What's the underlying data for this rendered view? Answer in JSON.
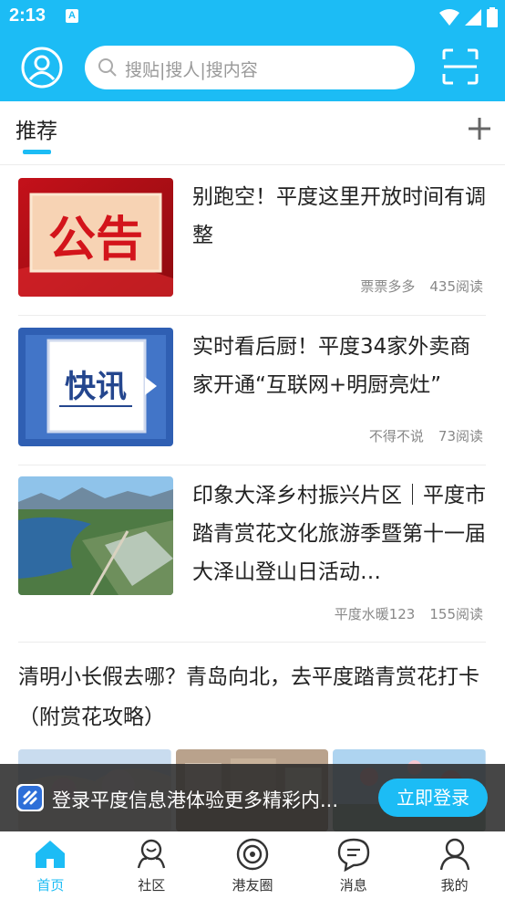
{
  "status_bar": {
    "time": "2:13",
    "notification_badge": "A"
  },
  "header": {
    "search_placeholder": "搜贴|搜人|搜内容"
  },
  "tabs": {
    "recommend_label": "推荐"
  },
  "articles": [
    {
      "title": "别跑空！平度这里开放时间有调整",
      "author": "票票多多",
      "reads": "435阅读",
      "thumb_text": "公告"
    },
    {
      "title": "实时看后厨！平度34家外卖商家开通“互联网+明厨亮灶”",
      "author": "不得不说",
      "reads": "73阅读",
      "thumb_text": "快讯"
    },
    {
      "title": "印象大泽乡村振兴片区｜平度市踏青赏花文化旅游季暨第十一届大泽山登山日活动…",
      "author": "平度水暖123",
      "reads": "155阅读"
    }
  ],
  "article_full": {
    "title": "清明小长假去哪？青岛向北，去平度踏青赏花打卡（附赏花攻略）"
  },
  "login_banner": {
    "text": "登录平度信息港体验更多精彩内...",
    "button_label": "立即登录"
  },
  "bottom_nav": [
    {
      "label": "首页",
      "icon": "home-icon",
      "active": true
    },
    {
      "label": "社区",
      "icon": "community-icon",
      "active": false
    },
    {
      "label": "港友圈",
      "icon": "friends-circle-icon",
      "active": false
    },
    {
      "label": "消息",
      "icon": "message-icon",
      "active": false
    },
    {
      "label": "我的",
      "icon": "profile-icon",
      "active": false
    }
  ],
  "colors": {
    "accent": "#1cbcf5",
    "banner_bg": "#282828",
    "text_meta": "#888888"
  }
}
